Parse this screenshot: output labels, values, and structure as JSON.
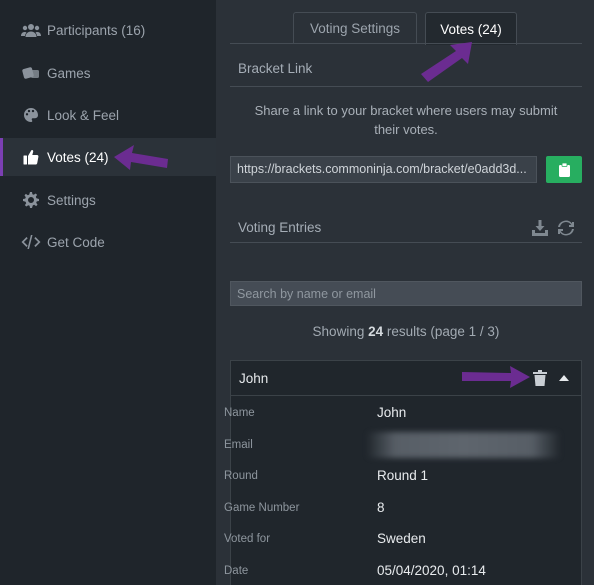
{
  "sidebar": {
    "items": [
      {
        "label": "Participants (16)",
        "icon": "users-icon",
        "active": false
      },
      {
        "label": "Games",
        "icon": "dice-icon",
        "active": false
      },
      {
        "label": "Look & Feel",
        "icon": "palette-icon",
        "active": false
      },
      {
        "label": "Votes (24)",
        "icon": "thumbs-up-icon",
        "active": true
      },
      {
        "label": "Settings",
        "icon": "gear-icon",
        "active": false
      },
      {
        "label": "Get Code",
        "icon": "code-icon",
        "active": false
      }
    ]
  },
  "tabs": [
    {
      "label": "Voting Settings",
      "active": false
    },
    {
      "label": "Votes (24)",
      "active": true
    }
  ],
  "bracket_link": {
    "title": "Bracket Link",
    "description": "Share a link to your bracket where users may submit their votes.",
    "url": "https://brackets.commoninja.com/bracket/e0add3d...",
    "copy_icon": "clipboard-icon"
  },
  "voting_entries": {
    "title": "Voting Entries",
    "download_icon": "download-icon",
    "refresh_icon": "refresh-icon"
  },
  "search": {
    "placeholder": "Search by name or email",
    "value": ""
  },
  "results": {
    "prefix": "Showing ",
    "count": "24",
    "suffix": " results (page 1 / 3)"
  },
  "entry": {
    "name": "John",
    "fields": [
      {
        "label": "Name",
        "value": "John"
      },
      {
        "label": "Email",
        "value": ""
      },
      {
        "label": "Round",
        "value": "Round 1"
      },
      {
        "label": "Game Number",
        "value": "8"
      },
      {
        "label": "Voted for",
        "value": "Sweden"
      },
      {
        "label": "Date",
        "value": "05/04/2020, 01:14"
      }
    ]
  },
  "colors": {
    "accent": "#7b3fb3",
    "copy_button": "#27ae60",
    "annotation_arrow": "#6b2c91"
  }
}
